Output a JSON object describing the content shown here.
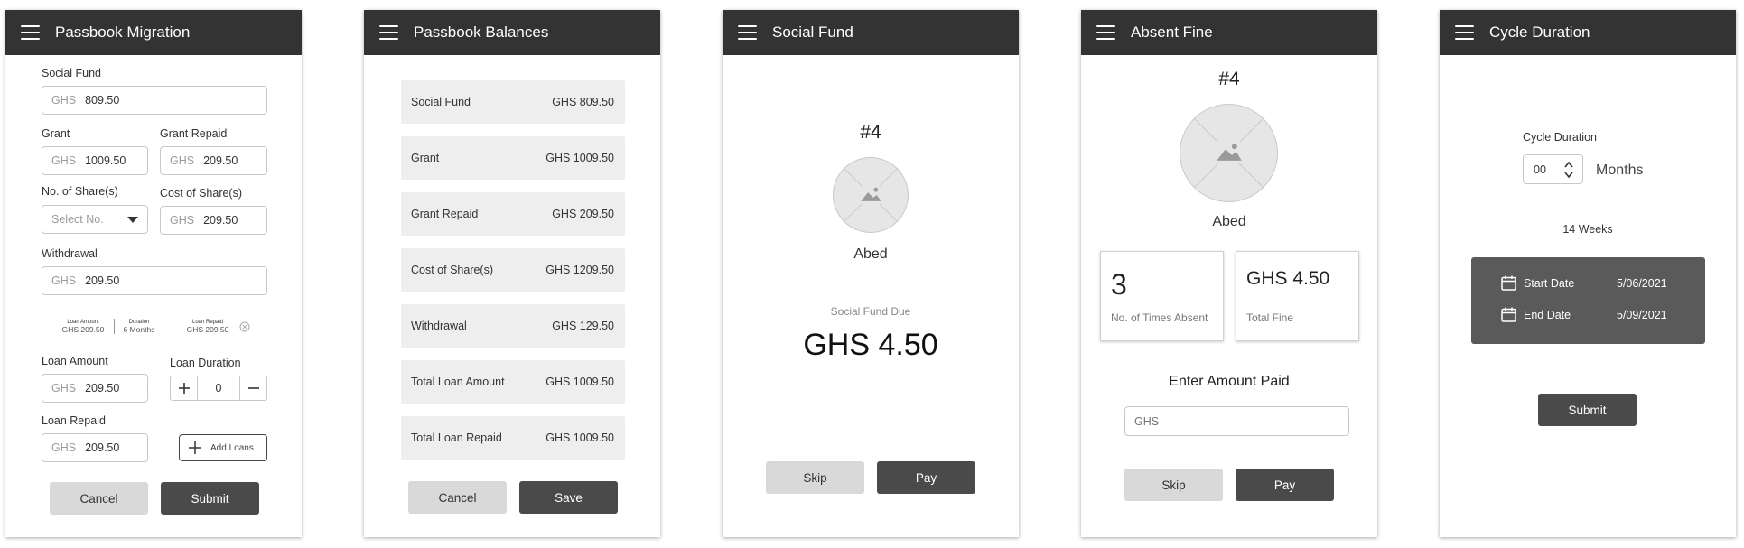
{
  "s1": {
    "title": "Passbook Migration",
    "social_fund": {
      "label": "Social Fund",
      "prefix": "GHS",
      "value": "809.50"
    },
    "grant": {
      "label": "Grant",
      "prefix": "GHS",
      "value": "1009.50"
    },
    "grant_repaid": {
      "label": "Grant Repaid",
      "prefix": "GHS",
      "value": "209.50"
    },
    "shares": {
      "label": "No. of Share(s)",
      "placeholder": "Select No."
    },
    "cost_shares": {
      "label": "Cost of Share(s)",
      "prefix": "GHS",
      "value": "209.50"
    },
    "withdrawal": {
      "label": "Withdrawal",
      "prefix": "GHS",
      "value": "209.50"
    },
    "summary": [
      {
        "label": "Loan Amount",
        "value": "GHS 209.50"
      },
      {
        "label": "Duration",
        "value": "6 Months"
      },
      {
        "label": "Loan Repaid",
        "value": "GHS 209.50"
      }
    ],
    "loan_amount": {
      "label": "Loan Amount",
      "prefix": "GHS",
      "value": "209.50"
    },
    "loan_duration": {
      "label": "Loan Duration",
      "value": "0"
    },
    "loan_repaid": {
      "label": "Loan Repaid",
      "prefix": "GHS",
      "value": "209.50"
    },
    "add_loans": "Add Loans",
    "cancel": "Cancel",
    "submit": "Submit"
  },
  "s2": {
    "title": "Passbook Balances",
    "rows": [
      {
        "label": "Social Fund",
        "value": "GHS 809.50"
      },
      {
        "label": "Grant",
        "value": "GHS 1009.50"
      },
      {
        "label": "Grant Repaid",
        "value": "GHS 209.50"
      },
      {
        "label": "Cost of Share(s)",
        "value": "GHS 1209.50"
      },
      {
        "label": "Withdrawal",
        "value": "GHS 129.50"
      },
      {
        "label": "Total Loan Amount",
        "value": "GHS 1009.50"
      },
      {
        "label": "Total Loan Repaid",
        "value": "GHS 1009.50"
      }
    ],
    "cancel": "Cancel",
    "save": "Save"
  },
  "s3": {
    "title": "Social Fund",
    "number": "#4",
    "name": "Abed",
    "due_label": "Social Fund Due",
    "due_amount": "GHS 4.50",
    "skip": "Skip",
    "pay": "Pay"
  },
  "s4": {
    "title": "Absent Fine",
    "number": "#4",
    "name": "Abed",
    "times_absent": "3",
    "times_absent_label": "No. of Times Absent",
    "total_fine": "GHS 4.50",
    "total_fine_label": "Total Fine",
    "enter_label": "Enter Amount Paid",
    "input_placeholder": "GHS",
    "skip": "Skip",
    "pay": "Pay"
  },
  "s5": {
    "title": "Cycle Duration",
    "cycle_label": "Cycle Duration",
    "cycle_value": "00",
    "months": "Months",
    "weeks": "14 Weeks",
    "start_label": "Start Date",
    "start_value": "5/06/2021",
    "end_label": "End Date",
    "end_value": "5/09/2021",
    "submit": "Submit"
  }
}
